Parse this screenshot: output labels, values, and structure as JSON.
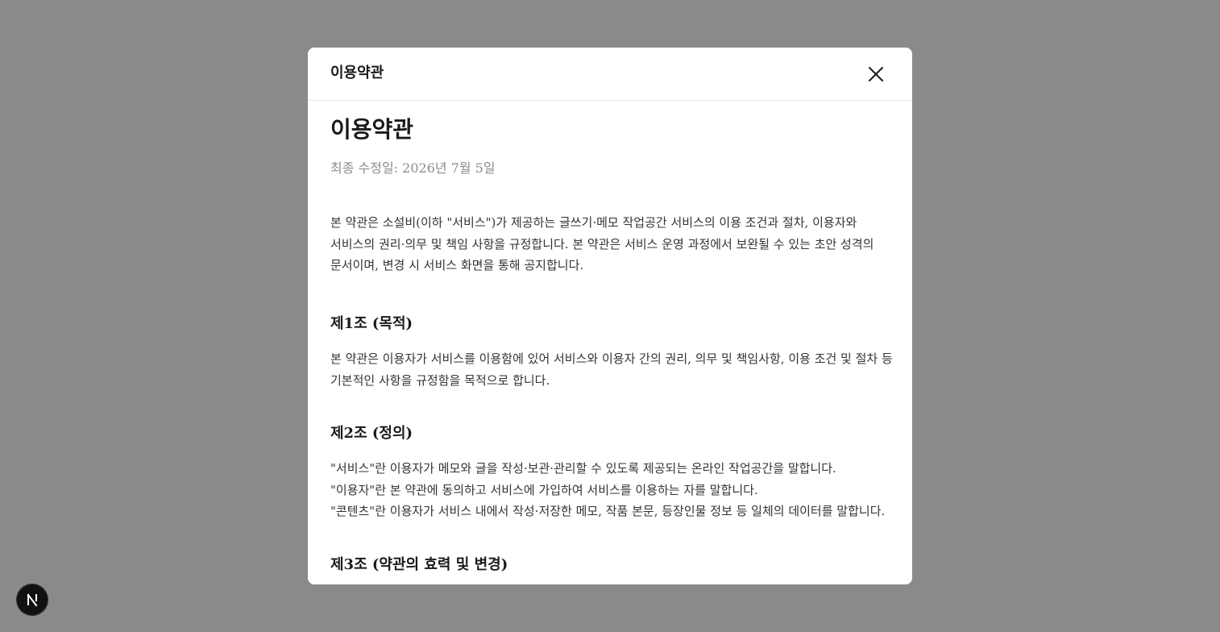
{
  "modal": {
    "header_title": "이용약관",
    "close_icon": "close-icon"
  },
  "doc": {
    "title": "이용약관",
    "updated": "최종 수정일: 2026년 7월 5일",
    "intro": [
      "본 약관은 소설비(이하 \"서비스\")가 제공하는 글쓰기·메모 작업공간 서비스의 이용 조건과 절차, 이용자와",
      "서비스의 권리·의무 및 책임 사항을 규정합니다. 본 약관은 서비스 운영 과정에서 보완될 수 있는 초안 성격의",
      "문서이며, 변경 시 서비스 화면을 통해 공지합니다."
    ],
    "sections": [
      {
        "title": "제1조 (목적)",
        "lines": [
          "본 약관은 이용자가 서비스를 이용함에 있어 서비스와 이용자 간의 권리, 의무 및 책임사항, 이용 조건 및 절차 등",
          "기본적인 사항을 규정함을 목적으로 합니다."
        ]
      },
      {
        "title": "제2조 (정의)",
        "lines": [
          "\"서비스\"란 이용자가 메모와 글을 작성·보관·관리할 수 있도록 제공되는 온라인 작업공간을 말합니다.",
          "\"이용자\"란 본 약관에 동의하고 서비스에 가입하여 서비스를 이용하는 자를 말합니다.",
          "\"콘텐츠\"란 이용자가 서비스 내에서 작성·저장한 메모, 작품 본문, 등장인물 정보 등 일체의 데이터를 말합니다."
        ]
      },
      {
        "title": "제3조 (약관의 효력 및 변경)",
        "lines": []
      }
    ]
  },
  "fab": {
    "label": "N",
    "icon": "nextjs-logo-icon"
  }
}
